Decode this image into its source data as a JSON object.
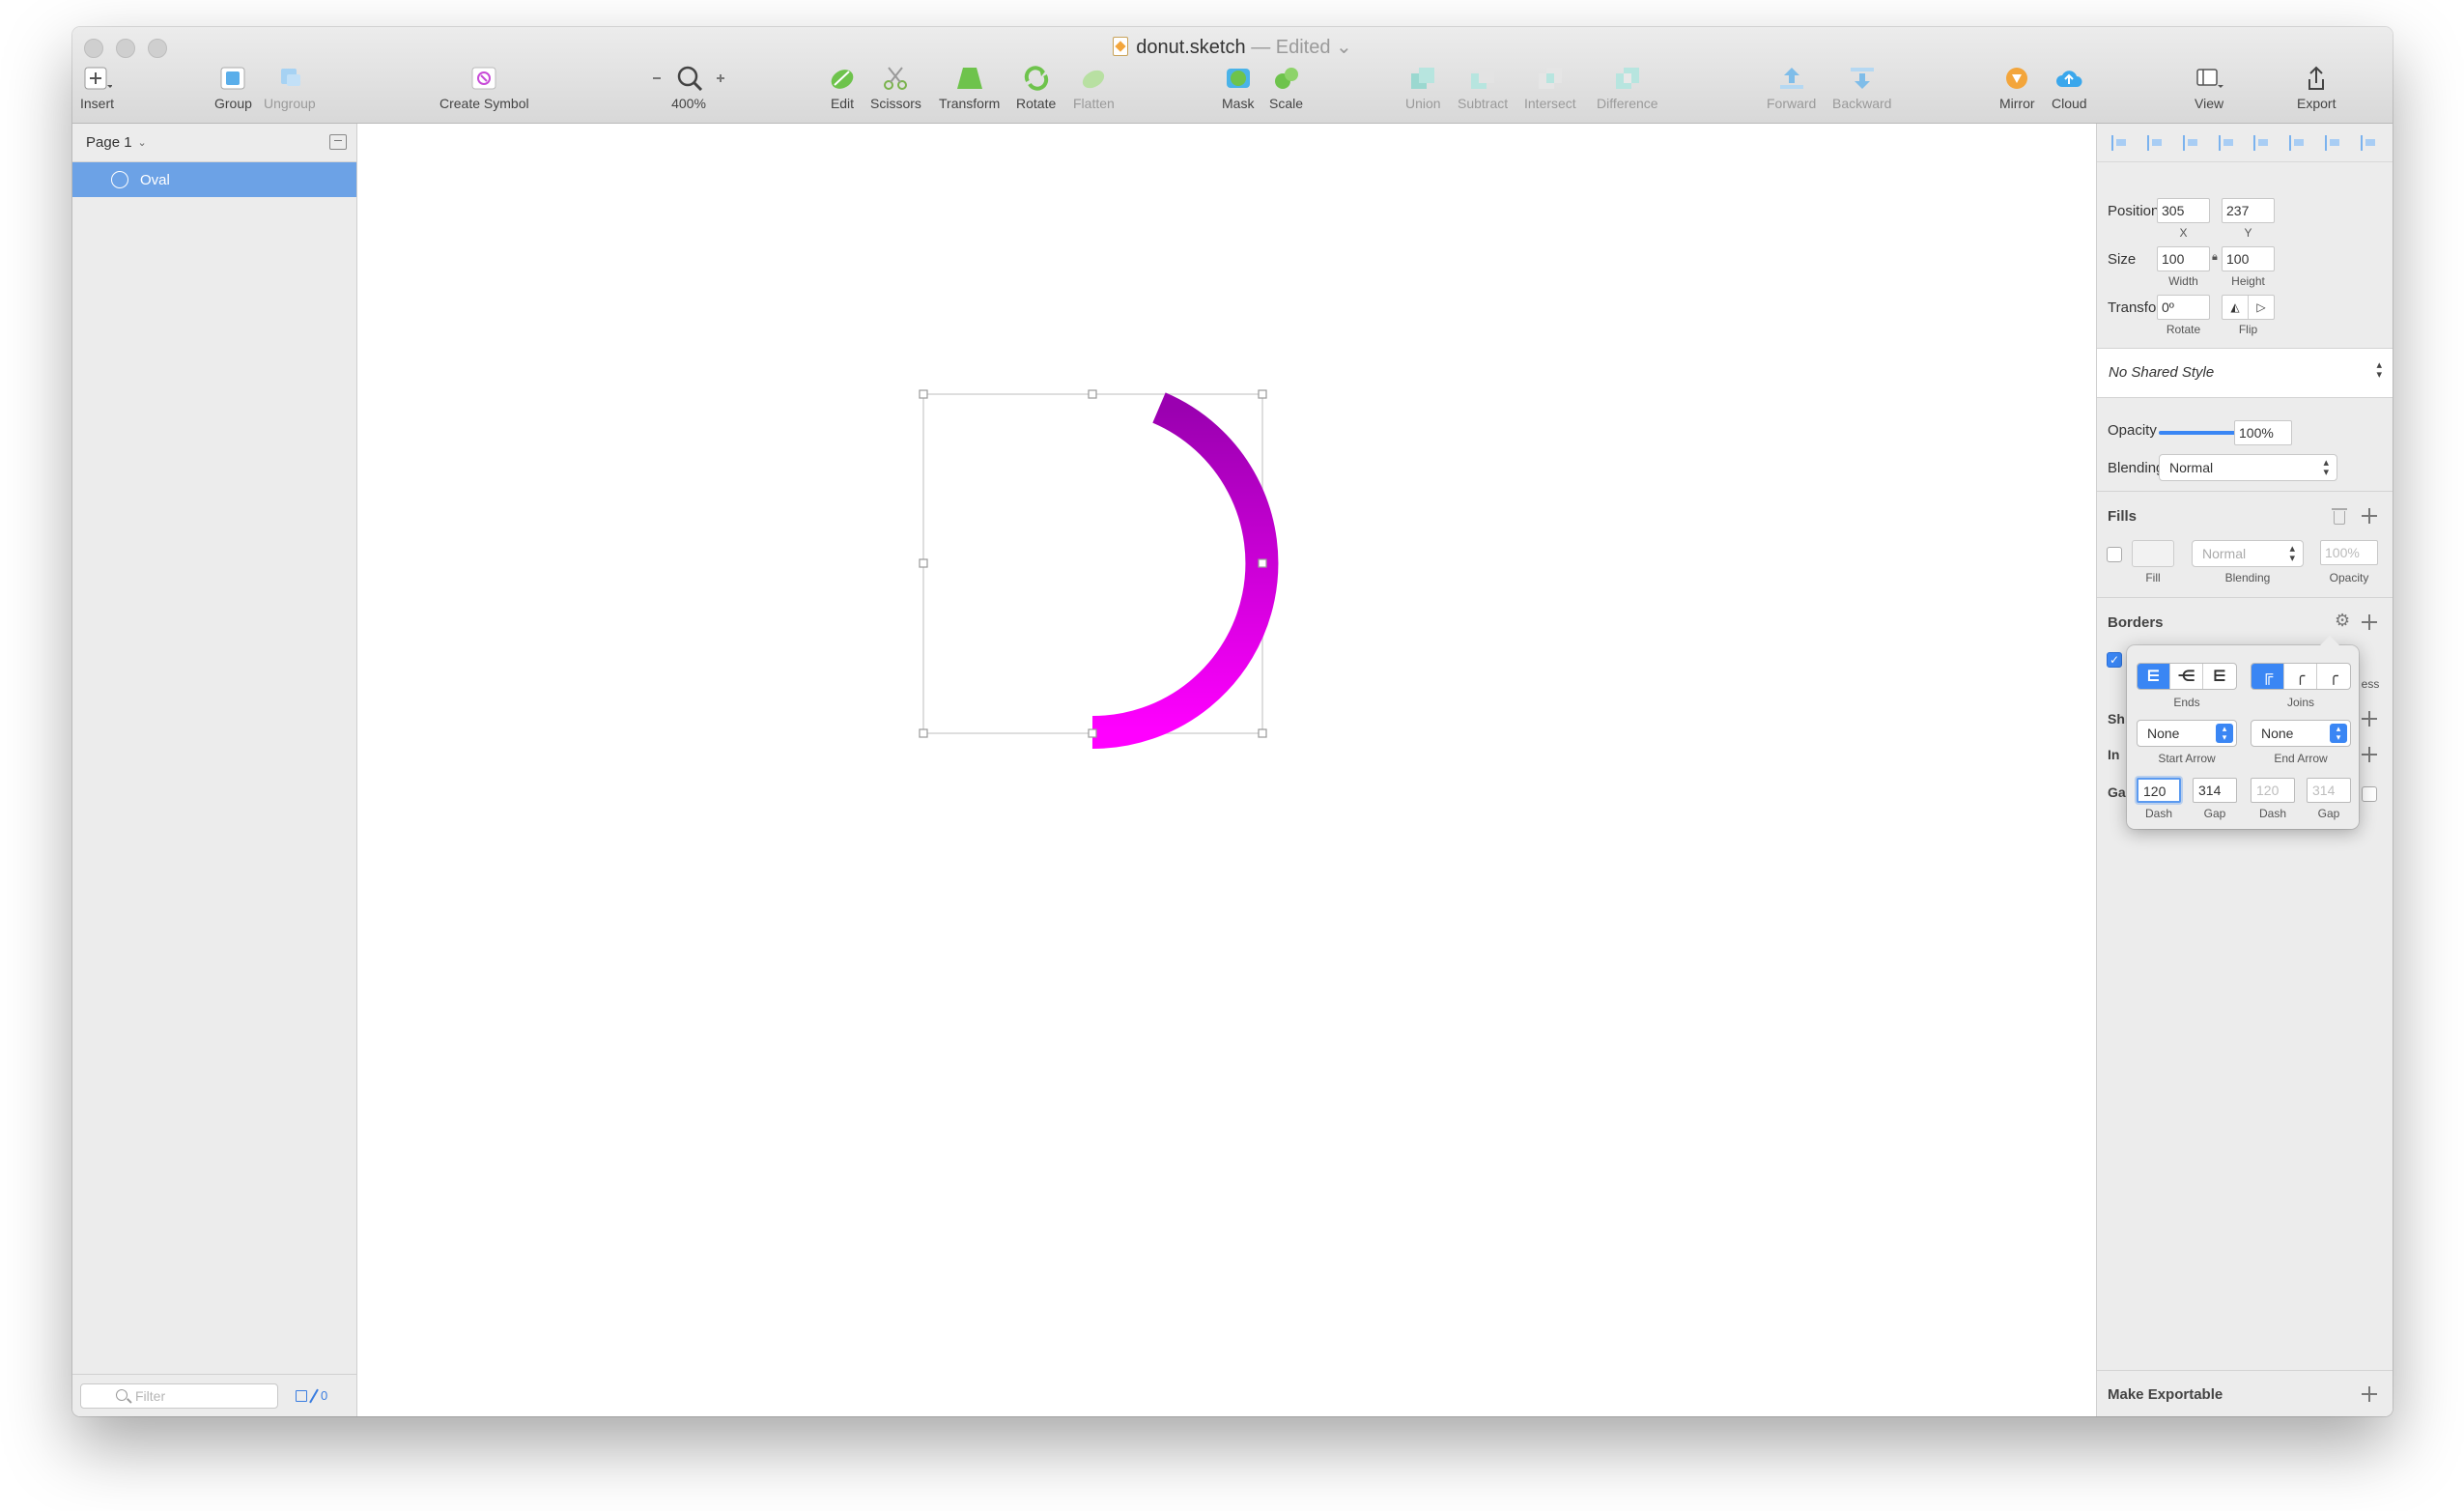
{
  "window": {
    "title": "donut.sketch",
    "edited": "— Edited"
  },
  "toolbar": {
    "insert": "Insert",
    "group": "Group",
    "ungroup": "Ungroup",
    "create_symbol": "Create Symbol",
    "zoom": "400%",
    "edit": "Edit",
    "scissors": "Scissors",
    "transform": "Transform",
    "rotate": "Rotate",
    "flatten": "Flatten",
    "mask": "Mask",
    "scale": "Scale",
    "union": "Union",
    "subtract": "Subtract",
    "intersect": "Intersect",
    "difference": "Difference",
    "forward": "Forward",
    "backward": "Backward",
    "mirror": "Mirror",
    "cloud": "Cloud",
    "view": "View",
    "export": "Export"
  },
  "layers": {
    "page": "Page 1",
    "items": [
      {
        "label": "Oval"
      }
    ],
    "filter_placeholder": "Filter",
    "slice_count": "0"
  },
  "canvas": {
    "arc_color_start": "#9a00b0",
    "arc_color_end": "#ff00ff"
  },
  "inspector": {
    "position_label": "Position",
    "x": "305",
    "y": "237",
    "x_label": "X",
    "y_label": "Y",
    "size_label": "Size",
    "width": "100",
    "height": "100",
    "width_label": "Width",
    "height_label": "Height",
    "transform_label": "Transform",
    "rotate": "0º",
    "rotate_label": "Rotate",
    "flip_label": "Flip",
    "shared_style": "No Shared Style",
    "opacity_label": "Opacity",
    "opacity": "100%",
    "opacity_level": 1.0,
    "blending_label": "Blending",
    "blending": "Normal",
    "fills_title": "Fills",
    "fill_blending": "Normal",
    "fill_opacity": "100%",
    "fill_label": "Fill",
    "fill_blending_label": "Blending",
    "fill_opacity_label": "Opacity",
    "borders_title": "Borders",
    "border_color": "#a200b8",
    "shadows_title": "Sh",
    "inner_title": "In",
    "gaussian_title": "Ga",
    "thickness_label_partial": "ess",
    "make_exportable": "Make Exportable"
  },
  "popover": {
    "ends_label": "Ends",
    "joins_label": "Joins",
    "start_arrow": "None",
    "end_arrow": "None",
    "start_arrow_label": "Start Arrow",
    "end_arrow_label": "End Arrow",
    "dash1": "120",
    "gap1": "314",
    "dash2": "120",
    "gap2": "314",
    "dash_label": "Dash",
    "gap_label": "Gap"
  },
  "colors": {
    "accent": "#3a86f4",
    "selection": "#6ca2e6"
  }
}
